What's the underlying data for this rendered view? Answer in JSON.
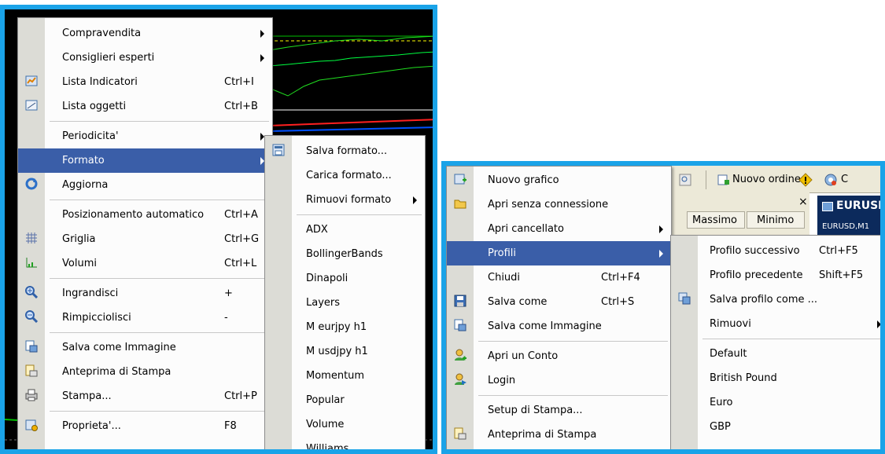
{
  "left_menu": {
    "items": [
      {
        "label": "Compravendita",
        "shortcut": "",
        "submenu": true,
        "icon": ""
      },
      {
        "label": "Consiglieri esperti",
        "shortcut": "",
        "submenu": true,
        "icon": ""
      },
      {
        "label": "Lista Indicatori",
        "shortcut": "Ctrl+I",
        "submenu": false,
        "icon": "indicator-list-icon"
      },
      {
        "label": "Lista oggetti",
        "shortcut": "Ctrl+B",
        "submenu": false,
        "icon": "objects-list-icon"
      },
      {
        "label": "Periodicita'",
        "shortcut": "",
        "submenu": true,
        "icon": ""
      },
      {
        "label": "Formato",
        "shortcut": "",
        "submenu": true,
        "icon": "",
        "highlighted": true
      },
      {
        "label": "Aggiorna",
        "shortcut": "",
        "submenu": false,
        "icon": "refresh-icon"
      },
      {
        "label": "Posizionamento automatico",
        "shortcut": "Ctrl+A",
        "submenu": false,
        "icon": ""
      },
      {
        "label": "Griglia",
        "shortcut": "Ctrl+G",
        "submenu": false,
        "icon": "grid-icon"
      },
      {
        "label": "Volumi",
        "shortcut": "Ctrl+L",
        "submenu": false,
        "icon": "volumes-icon"
      },
      {
        "label": "Ingrandisci",
        "shortcut": "+",
        "submenu": false,
        "icon": "zoom-in-icon"
      },
      {
        "label": "Rimpicciolisci",
        "shortcut": "-",
        "submenu": false,
        "icon": "zoom-out-icon"
      },
      {
        "label": "Salva come Immagine",
        "shortcut": "",
        "submenu": false,
        "icon": "save-image-icon"
      },
      {
        "label": "Anteprima di Stampa",
        "shortcut": "",
        "submenu": false,
        "icon": "print-preview-icon"
      },
      {
        "label": "Stampa...",
        "shortcut": "Ctrl+P",
        "submenu": false,
        "icon": "print-icon"
      },
      {
        "label": "Proprieta'...",
        "shortcut": "F8",
        "submenu": false,
        "icon": "properties-icon"
      }
    ]
  },
  "formato_submenu": {
    "items": [
      {
        "label": "Salva formato...",
        "submenu": false,
        "icon": "save-template-icon"
      },
      {
        "label": "Carica formato...",
        "submenu": false,
        "icon": ""
      },
      {
        "label": "Rimuovi formato",
        "submenu": true,
        "icon": ""
      },
      {
        "label": "ADX"
      },
      {
        "label": "BollingerBands"
      },
      {
        "label": "Dinapoli"
      },
      {
        "label": "Layers"
      },
      {
        "label": "M eurjpy h1"
      },
      {
        "label": "M usdjpy h1"
      },
      {
        "label": "Momentum"
      },
      {
        "label": "Popular"
      },
      {
        "label": "Volume"
      },
      {
        "label": "Williams"
      }
    ]
  },
  "toolbar": {
    "new_order": "Nuovo ordine",
    "cut_text": "C",
    "close_x": "×",
    "col_massimo": "Massimo",
    "col_minimo": "Minimo",
    "chart_tab": "EURUSD",
    "chart_subtitle": "EURUSD,M1"
  },
  "right_menu": {
    "items": [
      {
        "label": "Nuovo grafico",
        "shortcut": "",
        "submenu": false,
        "icon": "new-chart-icon"
      },
      {
        "label": "Apri senza connessione",
        "shortcut": "",
        "submenu": false,
        "icon": "open-offline-icon"
      },
      {
        "label": "Apri cancellato",
        "shortcut": "",
        "submenu": true,
        "icon": ""
      },
      {
        "label": "Profili",
        "shortcut": "",
        "submenu": true,
        "icon": "",
        "highlighted": true
      },
      {
        "label": "Chiudi",
        "shortcut": "Ctrl+F4",
        "submenu": false,
        "icon": ""
      },
      {
        "label": "Salva come",
        "shortcut": "Ctrl+S",
        "submenu": false,
        "icon": "save-icon"
      },
      {
        "label": "Salva come Immagine",
        "shortcut": "",
        "submenu": false,
        "icon": "save-image-icon"
      },
      {
        "label": "Apri un Conto",
        "shortcut": "",
        "submenu": false,
        "icon": "open-account-icon"
      },
      {
        "label": "Login",
        "shortcut": "",
        "submenu": false,
        "icon": "login-icon"
      },
      {
        "label": "Setup di Stampa...",
        "shortcut": "",
        "submenu": false,
        "icon": ""
      },
      {
        "label": "Anteprima di Stampa",
        "shortcut": "",
        "submenu": false,
        "icon": "print-preview-icon"
      }
    ]
  },
  "profili_submenu": {
    "items": [
      {
        "label": "Profilo successivo",
        "shortcut": "Ctrl+F5",
        "submenu": false,
        "icon": ""
      },
      {
        "label": "Profilo precedente",
        "shortcut": "Shift+F5",
        "submenu": false,
        "icon": ""
      },
      {
        "label": "Salva profilo come ...",
        "shortcut": "",
        "submenu": false,
        "icon": "save-profile-icon"
      },
      {
        "label": "Rimuovi",
        "shortcut": "",
        "submenu": true,
        "icon": ""
      },
      {
        "label": "Default",
        "shortcut": "",
        "submenu": false,
        "icon": ""
      },
      {
        "label": "British Pound",
        "shortcut": "",
        "submenu": false,
        "icon": ""
      },
      {
        "label": "Euro",
        "shortcut": "",
        "submenu": false,
        "icon": ""
      },
      {
        "label": "GBP",
        "shortcut": "",
        "submenu": false,
        "icon": ""
      }
    ]
  },
  "colors": {
    "frame_border": "#1aa3e8",
    "highlight": "#3a5ea8",
    "gutter": "#dcdcd6",
    "chart_bg": "#000000"
  }
}
